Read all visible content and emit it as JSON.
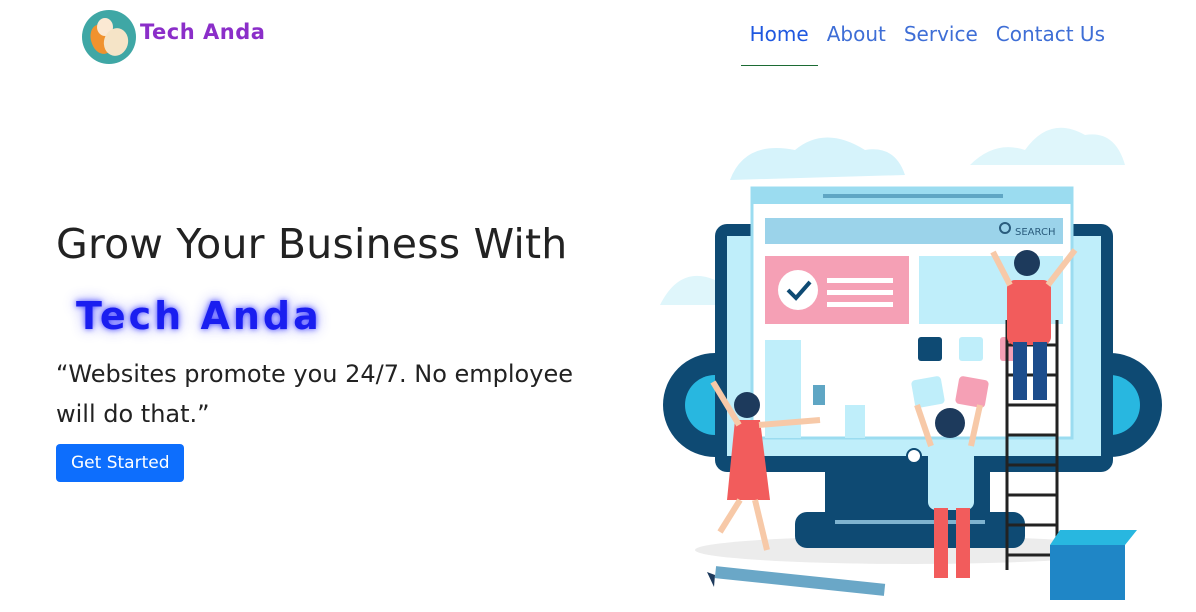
{
  "navbar": {
    "brand_name": "Tech Anda",
    "links": [
      {
        "label": "Home",
        "active": true
      },
      {
        "label": "About",
        "active": false
      },
      {
        "label": "Service",
        "active": false
      },
      {
        "label": "Contact Us",
        "active": false
      }
    ]
  },
  "hero": {
    "title": "Grow Your Business With",
    "brand": "Tech Anda",
    "quote": "“Websites promote you 24/7. No employee will do that.”",
    "cta_label": "Get Started"
  },
  "illustration": {
    "search_label": "SEARCH"
  },
  "colors": {
    "brand_purple": "#8b2ec9",
    "nav_link": "#3e6ed6",
    "hero_brand_blue": "#1a1ef0",
    "cta_blue": "#0d6efd",
    "active_underline": "#1c6b34"
  }
}
